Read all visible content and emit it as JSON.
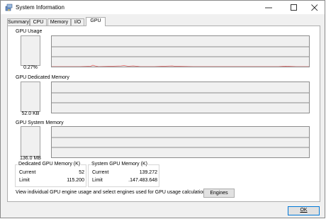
{
  "window": {
    "title": "System Information"
  },
  "tabs": [
    "Summary",
    "CPU",
    "Memory",
    "I/O",
    "GPU"
  ],
  "active_tab": "GPU",
  "sections": {
    "usage": {
      "label": "GPU Usage",
      "value": "0.27%",
      "level": 0.0027
    },
    "dedicated": {
      "label": "GPU Dedicated Memory",
      "value": "52.0 KB"
    },
    "system": {
      "label": "GPU System Memory",
      "value": "136.0 MB"
    }
  },
  "dedicated_group": {
    "title": "Dedicated GPU Memory (K)",
    "current_label": "Current",
    "current_value": "52",
    "limit_label": "Limit",
    "limit_value": "115.200"
  },
  "system_group": {
    "title": "System GPU Memory (K)",
    "current_label": "Current",
    "current_value": "139.272",
    "limit_label": "Limit",
    "limit_value": ".147.483.648"
  },
  "footer": {
    "text": "View individual GPU engine usage and select engines used for GPU usage calculations:",
    "engines_button": "Engines"
  },
  "ok_button": "OK",
  "colors": {
    "usage_line": "#e05c5c",
    "graph_bg": "#f0f0f0",
    "grid": "#8c8c8c",
    "ok_border": "#0078d7"
  }
}
